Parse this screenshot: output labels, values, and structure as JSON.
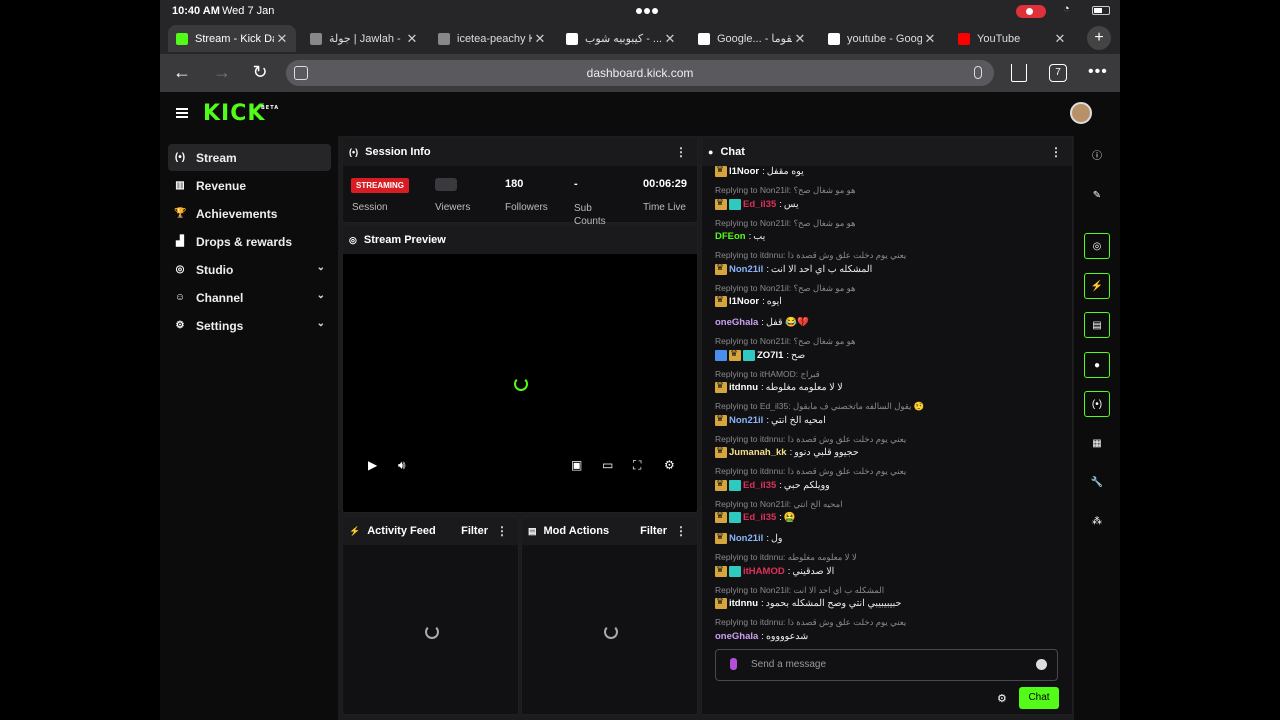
{
  "status": {
    "time": "10:40 AM",
    "date": "Wed 7 Jan"
  },
  "tabs": [
    {
      "label": "Stream - Kick Dashboard",
      "active": true,
      "favicon": "kick-favicon",
      "color": "#53fc18"
    },
    {
      "label": "جولة | Jawlah -",
      "active": false,
      "favicon": "globe-favicon",
      "color": "#888888"
    },
    {
      "label": "icetea-peachy Kick",
      "active": false,
      "favicon": "diamond-favicon",
      "color": "#888888"
    },
    {
      "label": "كيبوبيه شوب - ...",
      "active": false,
      "favicon": "google-favicon",
      "color": "#ffffff"
    },
    {
      "label": "Google... - نقوما",
      "active": false,
      "favicon": "google-favicon",
      "color": "#ffffff"
    },
    {
      "label": "youtube - Google Search",
      "active": false,
      "favicon": "google-favicon",
      "color": "#ffffff"
    },
    {
      "label": "YouTube",
      "active": false,
      "favicon": "youtube-favicon",
      "color": "#ff0000"
    }
  ],
  "browser": {
    "url": "dashboard.kick.com",
    "tab_count": "7",
    "new_tab": "+"
  },
  "brand": {
    "logo": "KICK",
    "beta": "BETA",
    "accent": "#53fc18"
  },
  "sidebar": {
    "items": [
      {
        "label": "Stream",
        "icon": "broadcast-icon",
        "glyph": "(•)",
        "active": true,
        "expand": false
      },
      {
        "label": "Revenue",
        "icon": "chart-icon",
        "glyph": "▥",
        "active": false,
        "expand": false
      },
      {
        "label": "Achievements",
        "icon": "trophy-icon",
        "glyph": "🏆",
        "active": false,
        "expand": false
      },
      {
        "label": "Drops & rewards",
        "icon": "gift-icon",
        "glyph": "▟",
        "active": false,
        "expand": false
      },
      {
        "label": "Studio",
        "icon": "studio-icon",
        "glyph": "◎",
        "active": false,
        "expand": true
      },
      {
        "label": "Channel",
        "icon": "users-icon",
        "glyph": "☺",
        "active": false,
        "expand": true
      },
      {
        "label": "Settings",
        "icon": "gear-icon",
        "glyph": "⚙",
        "active": false,
        "expand": true
      }
    ]
  },
  "session": {
    "title": "Session Info",
    "status_badge": "STREAMING",
    "session_label": "Session",
    "viewers_label": "Viewers",
    "followers_value": "180",
    "followers_label": "Followers",
    "subs_value": "-",
    "subs_label": "Sub Counts",
    "time_value": "00:06:29",
    "time_label": "Time Live"
  },
  "preview": {
    "title": "Stream Preview"
  },
  "activity": {
    "title": "Activity Feed",
    "filter": "Filter"
  },
  "mod": {
    "title": "Mod Actions",
    "filter": "Filter"
  },
  "chat": {
    "title": "Chat",
    "placeholder": "Send a message",
    "send": "Chat",
    "messages": [
      {
        "reply": "",
        "badges": [
          "crown"
        ],
        "user": "l1Noor",
        "color": "#ffffff",
        "text": "يوه مقفل"
      },
      {
        "reply": "Replying to Non21il: هو مو شغال صح؟",
        "badges": [
          "crown",
          "teal"
        ],
        "user": "Ed_il35",
        "color": "#e0305a",
        "text": "يس"
      },
      {
        "reply": "Replying to Non21il: هو مو شغال صح؟",
        "badges": [],
        "user": "DFEon",
        "color": "#53fc18",
        "text": "يب"
      },
      {
        "reply": "Replying to itdnnu: يعني يوم دخلت علق وش قصدة ذا",
        "badges": [
          "crown"
        ],
        "user": "Non21il",
        "color": "#8ab4f8",
        "text": "المشكله ب اي احد الا انت"
      },
      {
        "reply": "Replying to Non21il: هو مو شغال صح؟",
        "badges": [
          "crown"
        ],
        "user": "l1Noor",
        "color": "#ffffff",
        "text": "ايوه"
      },
      {
        "reply": "",
        "badges": [],
        "user": "oneGhala",
        "color": "#c9a0f0",
        "text": "قفل 😂💔"
      },
      {
        "reply": "Replying to Non21il: هو مو شغال صح؟",
        "badges": [
          "blue",
          "crown",
          "teal"
        ],
        "user": "ZO7l1",
        "color": "#ffffff",
        "text": "صح"
      },
      {
        "reply": "Replying to itHAMOD: قبراج",
        "badges": [
          "crown"
        ],
        "user": "itdnnu",
        "color": "#ffffff",
        "text": "لا لا معلومه مغلوطه"
      },
      {
        "reply": "Replying to Ed_il35: يقول السالفه ماتخصني ف مابقول 🤨",
        "badges": [
          "crown"
        ],
        "user": "Non21il",
        "color": "#8ab4f8",
        "text": "امحيه الخ انتي"
      },
      {
        "reply": "Replying to itdnnu: يعني يوم دخلت علق وش قصدة ذا",
        "badges": [
          "crown"
        ],
        "user": "Jumanah_kk",
        "color": "#f5e08a",
        "text": "حجيوو قلبي دنوو"
      },
      {
        "reply": "Replying to itdnnu: يعني يوم دخلت علق وش قصدة ذا",
        "badges": [
          "crown",
          "teal"
        ],
        "user": "Ed_il35",
        "color": "#e0305a",
        "text": "وويلكم حبي"
      },
      {
        "reply": "Replying to Non21il: امحيه الخ انتي",
        "badges": [
          "crown",
          "teal"
        ],
        "user": "Ed_il35",
        "color": "#e0305a",
        "text": "🤮"
      },
      {
        "reply": "",
        "badges": [
          "crown"
        ],
        "user": "Non21il",
        "color": "#8ab4f8",
        "text": "ول"
      },
      {
        "reply": "Replying to itdnnu: لا لا معلومه مغلوطه",
        "badges": [
          "crown",
          "teal"
        ],
        "user": "itHAMOD",
        "color": "#e0305a",
        "text": "الا صدقيني"
      },
      {
        "reply": "Replying to Non21il: المشكله ب اي احد الا انت",
        "badges": [
          "crown"
        ],
        "user": "itdnnu",
        "color": "#ffffff",
        "text": "حبيبيبيبي انتي وصح المشكله بحمود"
      },
      {
        "reply": "Replying to itdnnu: يعني يوم دخلت علق وش قصدة ذا",
        "badges": [],
        "user": "oneGhala",
        "color": "#c9a0f0",
        "text": "شدعووووه"
      }
    ]
  },
  "rail": [
    {
      "icon": "info-icon",
      "glyph": "ⓘ",
      "outlined": false
    },
    {
      "icon": "edit-icon",
      "glyph": "✎",
      "outlined": false
    },
    {
      "icon": "preview-icon",
      "glyph": "◎",
      "outlined": true
    },
    {
      "icon": "lightning-icon",
      "glyph": "⚡",
      "outlined": true
    },
    {
      "icon": "document-icon",
      "glyph": "▤",
      "outlined": true
    },
    {
      "icon": "chat-icon",
      "glyph": "●",
      "outlined": true
    },
    {
      "icon": "broadcast-icon",
      "glyph": "(•)",
      "outlined": true
    },
    {
      "icon": "layout-icon",
      "glyph": "▦",
      "outlined": false
    },
    {
      "icon": "wrench-icon",
      "glyph": "🔧",
      "outlined": false
    },
    {
      "icon": "dots-icon",
      "glyph": "⁂",
      "outlined": false
    }
  ]
}
